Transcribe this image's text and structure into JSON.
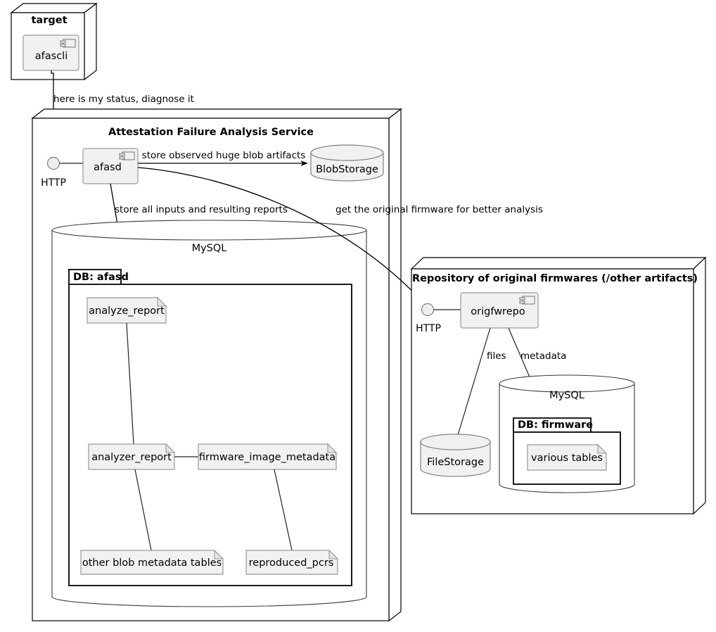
{
  "diagram": {
    "title": "Attestation Failure Analysis Service deployment diagram",
    "background": "#ffffff",
    "line_color": "#000000",
    "component_fill": "#f1f1f1",
    "component_stroke": "#9a9a9a"
  },
  "nodes": {
    "target": {
      "title": "target",
      "component": "afascli",
      "component_icon": "component-icon"
    },
    "afas": {
      "title": "Attestation Failure Analysis Service",
      "component": "afasd",
      "component_icon": "component-icon",
      "interface_label": "HTTP",
      "interface_icon": "lollipop-socket-icon"
    },
    "repo": {
      "title": "Repository of original firmwares (/other artifacts)",
      "component": "origfwrepo",
      "component_icon": "component-icon",
      "interface_label": "HTTP",
      "interface_icon": "lollipop-socket-icon"
    }
  },
  "storage": {
    "blob_storage": "BlobStorage",
    "file_storage": "FileStorage"
  },
  "databases": {
    "afas_mysql": {
      "engine": "MySQL",
      "package": "DB: afasd",
      "tables": [
        "analyze_report",
        "analyzer_report",
        "firmware_image_metadata",
        "other blob metadata tables",
        "reproduced_pcrs"
      ]
    },
    "firmware_mysql": {
      "engine": "MySQL",
      "package": "DB: firmware",
      "tables": [
        "various tables"
      ]
    }
  },
  "edges": {
    "target_to_afasd": "here is my status, diagnose it",
    "afasd_to_blobstorage": "store observed huge blob artifacts",
    "afasd_to_mysql": "store all inputs and resulting reports",
    "afasd_to_repo": "get the original firmware for better analysis",
    "origfwrepo_to_filestorage": "files",
    "origfwrepo_to_firmware_db": "metadata"
  }
}
